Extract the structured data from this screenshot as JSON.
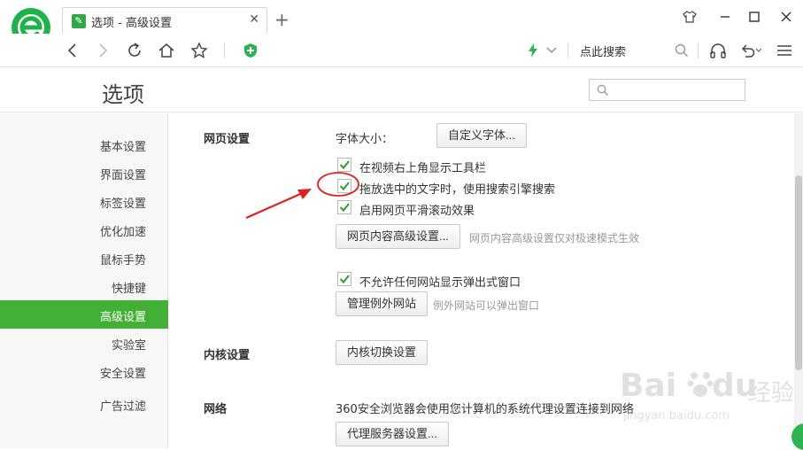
{
  "tab": {
    "title": "选项 - 高级设置"
  },
  "toolbar": {
    "search_label": "点此搜索"
  },
  "page": {
    "title": "选项"
  },
  "sidebar": {
    "items": [
      {
        "label": "基本设置"
      },
      {
        "label": "界面设置"
      },
      {
        "label": "标签设置"
      },
      {
        "label": "优化加速"
      },
      {
        "label": "鼠标手势"
      },
      {
        "label": "快捷键"
      },
      {
        "label": "高级设置"
      },
      {
        "label": "实验室"
      },
      {
        "label": "安全设置"
      },
      {
        "label": "广告过滤"
      }
    ],
    "active_index": 6
  },
  "webpage": {
    "section_title": "网页设置",
    "font_size_label": "字体大小：",
    "custom_font_button": "自定义字体...",
    "checkboxes": [
      {
        "label": "在视频右上角显示工具栏",
        "checked": true
      },
      {
        "label": "拖放选中的文字时，使用搜索引擎搜索",
        "checked": true
      },
      {
        "label": "启用网页平滑滚动效果",
        "checked": true
      }
    ],
    "advanced_button": "网页内容高级设置...",
    "advanced_hint": "网页内容高级设置仅对极速模式生效",
    "popup_checkbox": {
      "label": "不允许任何网站显示弹出式窗口",
      "checked": true
    },
    "exceptions_button": "管理例外网站",
    "exceptions_hint": "例外网站可以弹出窗口"
  },
  "kernel": {
    "section_title": "内核设置",
    "switch_button": "内核切换设置"
  },
  "network": {
    "section_title": "网络",
    "description": "360安全浏览器会使用您计算机的系统代理设置连接到网络",
    "proxy_button": "代理服务器设置..."
  },
  "watermark": {
    "brand": "Bai",
    "brand2": "du",
    "cn": "经验",
    "url": "jingyan.baidu.com"
  },
  "colors": {
    "accent": "#41b035",
    "annotation": "#e02020"
  }
}
